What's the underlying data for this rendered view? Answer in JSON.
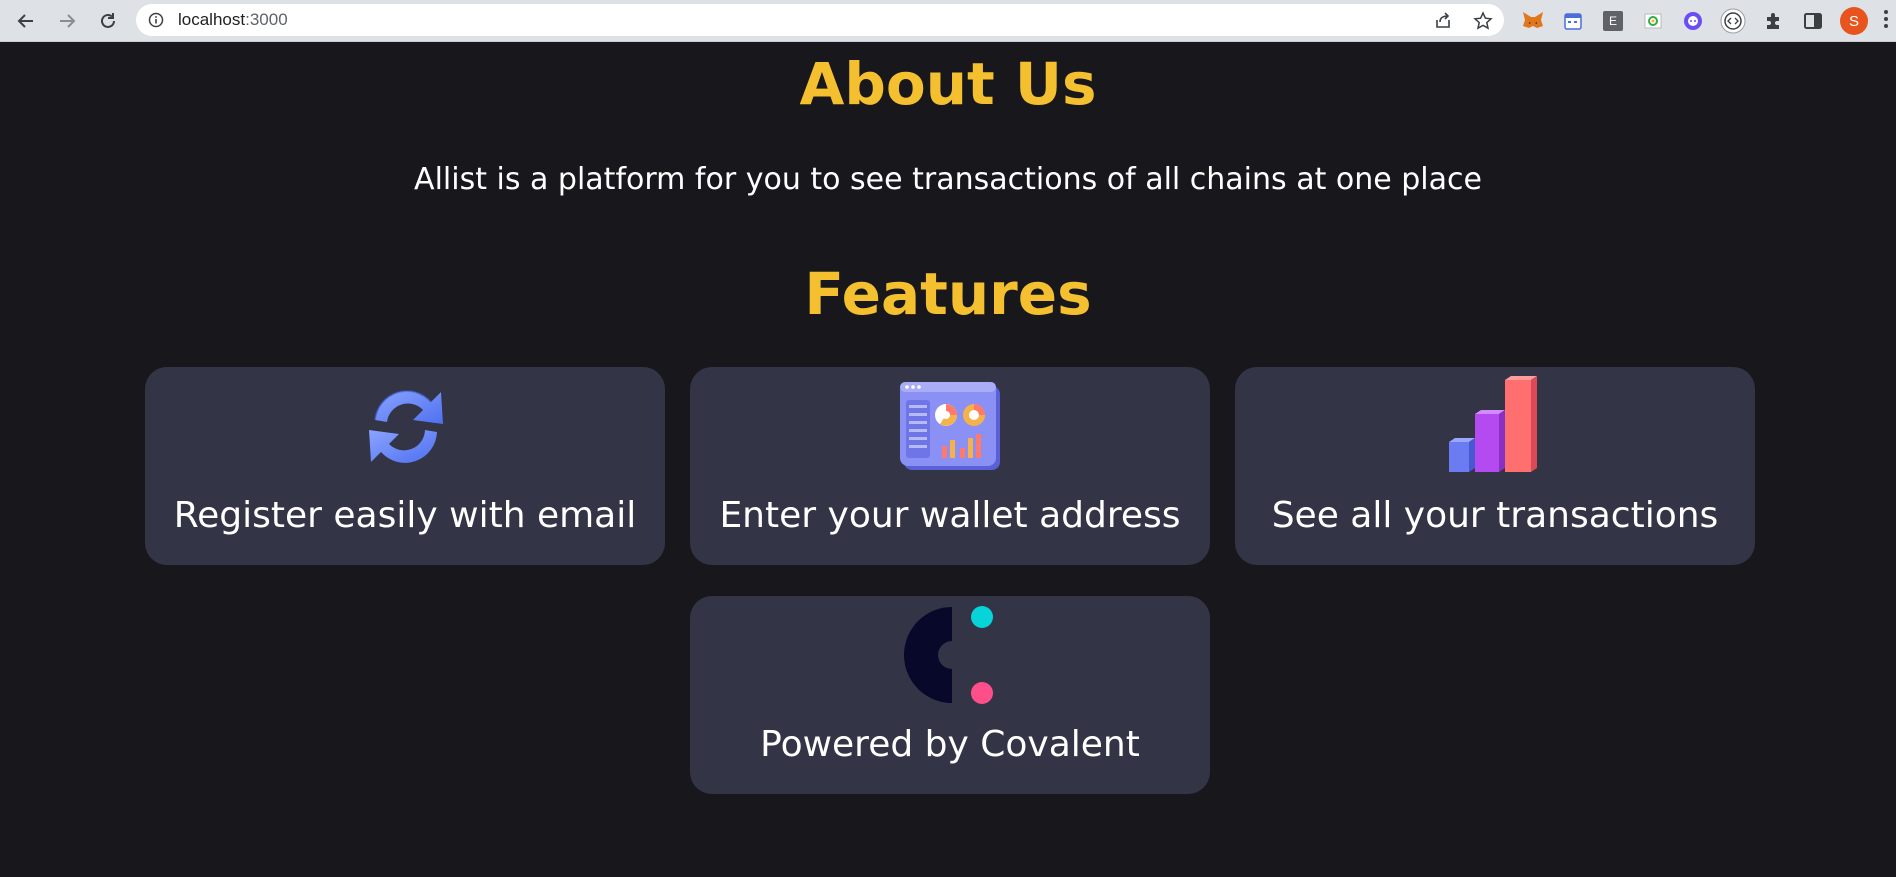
{
  "browser": {
    "url_host": "localhost",
    "url_port": ":3000",
    "profile_initial": "S",
    "extension_e_label": "E"
  },
  "about": {
    "title": "About Us",
    "description": "Allist is a platform for you to see transactions of all chains at one place"
  },
  "features": {
    "title": "Features",
    "items": [
      {
        "label": "Register easily with email",
        "icon": "refresh-arrows-icon"
      },
      {
        "label": "Enter your wallet address",
        "icon": "dashboard-window-icon"
      },
      {
        "label": "See all your transactions",
        "icon": "bar-chart-3d-icon"
      },
      {
        "label": "Powered by Covalent",
        "icon": "covalent-logo-icon"
      }
    ]
  },
  "colors": {
    "background": "#18171b",
    "heading": "#f4c030",
    "card": "#333445",
    "text": "#ffffff"
  }
}
